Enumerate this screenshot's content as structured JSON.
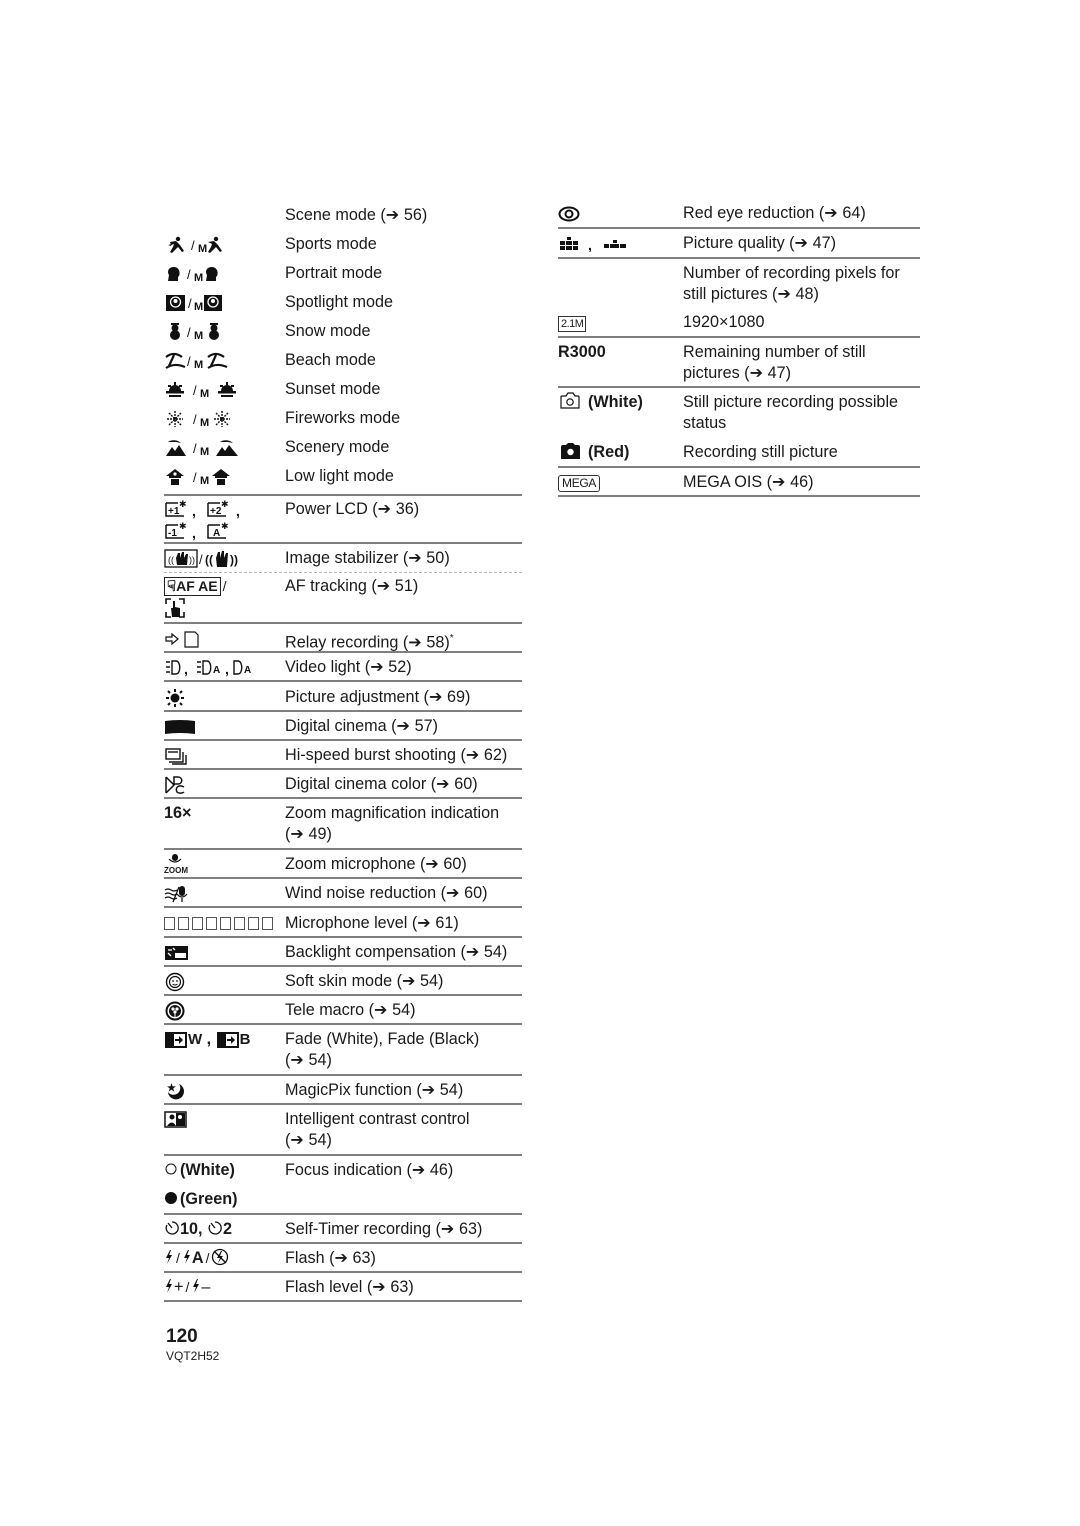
{
  "page": {
    "number": "120",
    "code": "VQT2H52"
  },
  "left_rows": [
    {
      "icon": "",
      "text": "Scene mode (➔ 56)"
    },
    {
      "icon": "sports-mode-icon",
      "text": "Sports mode"
    },
    {
      "icon": "portrait-mode-icon",
      "text": "Portrait mode"
    },
    {
      "icon": "spotlight-mode-icon",
      "text": "Spotlight mode"
    },
    {
      "icon": "snow-mode-icon",
      "text": "Snow mode"
    },
    {
      "icon": "beach-mode-icon",
      "text": "Beach mode"
    },
    {
      "icon": "sunset-mode-icon",
      "text": "Sunset mode"
    },
    {
      "icon": "fireworks-mode-icon",
      "text": "Fireworks mode"
    },
    {
      "icon": "scenery-mode-icon",
      "text": "Scenery mode"
    },
    {
      "icon": "low-light-mode-icon",
      "text": "Low light mode"
    },
    {
      "icon": "power-lcd-icon",
      "text": "Power LCD (➔ 36)"
    },
    {
      "icon": "image-stabilizer-icon",
      "text": "Image stabilizer (➔ 50)"
    },
    {
      "icon": "af-tracking-icon",
      "text": "AF tracking (➔ 51)",
      "icon_text": "AF AE"
    },
    {
      "icon": "relay-recording-icon",
      "text": "Relay recording (➔ 58)",
      "note": "*"
    },
    {
      "icon": "video-light-icon",
      "text": "Video light (➔ 52)"
    },
    {
      "icon": "picture-adjustment-icon",
      "text": "Picture adjustment (➔ 69)"
    },
    {
      "icon": "digital-cinema-icon",
      "text": "Digital cinema (➔ 57)"
    },
    {
      "icon": "burst-shooting-icon",
      "text": "Hi-speed burst shooting (➔ 62)"
    },
    {
      "icon": "digital-cinema-color-icon",
      "text": "Digital cinema color (➔ 60)"
    },
    {
      "icon": "",
      "icon_text": "16×",
      "text": "Zoom magnification indication",
      "text2": "(➔ 49)"
    },
    {
      "icon": "zoom-microphone-icon",
      "icon_text": "ZOOM",
      "text": "Zoom microphone (➔ 60)"
    },
    {
      "icon": "wind-noise-icon",
      "text": "Wind noise reduction (➔ 60)"
    },
    {
      "icon": "microphone-level-icon",
      "text": "Microphone level (➔ 61)"
    },
    {
      "icon": "backlight-icon",
      "text": "Backlight compensation (➔ 54)"
    },
    {
      "icon": "soft-skin-icon",
      "text": "Soft skin mode (➔ 54)"
    },
    {
      "icon": "tele-macro-icon",
      "text": "Tele macro (➔ 54)"
    },
    {
      "icon": "fade-icon",
      "icon_text": "W",
      "icon_text2": "B",
      "text": "Fade (White), Fade (Black)",
      "text2": "(➔ 54)"
    },
    {
      "icon": "magicpix-icon",
      "text": "MagicPix function (➔ 54)"
    },
    {
      "icon": "intelligent-contrast-icon",
      "text": "Intelligent contrast control",
      "text2": "(➔ 54)"
    },
    {
      "icon": "focus-white-icon",
      "icon_text": "(White)",
      "text": "Focus indication (➔ 46)"
    },
    {
      "icon": "focus-green-icon",
      "icon_text": "(Green)",
      "text": ""
    },
    {
      "icon": "self-timer-icon",
      "icon_text": "10,",
      "icon_text2": "2",
      "text": "Self-Timer recording (➔ 63)"
    },
    {
      "icon": "flash-icon",
      "icon_text": "A",
      "text": "Flash (➔ 63)"
    },
    {
      "icon": "flash-level-icon",
      "text": "Flash level (➔ 63)"
    }
  ],
  "right_rows": [
    {
      "icon": "red-eye-icon",
      "text": "Red eye reduction (➔ 64)"
    },
    {
      "icon": "picture-quality-icon",
      "text": "Picture quality (➔ 47)"
    },
    {
      "icon": "",
      "text": "Number of recording pixels for",
      "text2": "still pictures (➔ 48)"
    },
    {
      "icon": "pixels-icon",
      "icon_text": "2.1M",
      "text": "1920×1080"
    },
    {
      "icon": "",
      "icon_text": "R3000",
      "text": "Remaining number of still",
      "text2": "pictures (➔ 47)"
    },
    {
      "icon": "camera-outline-icon",
      "icon_text": "(White)",
      "text": "Still picture recording possible",
      "text2": "status"
    },
    {
      "icon": "camera-filled-icon",
      "icon_text": "(Red)",
      "text": "Recording still picture"
    },
    {
      "icon": "mega-ois-icon",
      "icon_text": "MEGA",
      "text": "MEGA OIS (➔ 46)"
    }
  ]
}
